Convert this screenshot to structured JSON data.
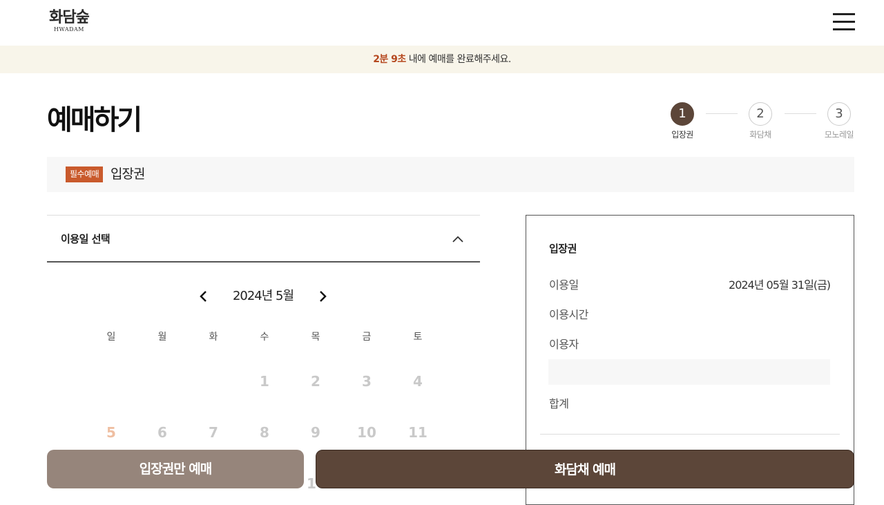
{
  "header": {
    "logo_ko": "화담숲",
    "logo_en": "HWADAM"
  },
  "timer": {
    "time": "2분 9초",
    "message": " 내에 예매를 완료해주세요."
  },
  "page_title": "예매하기",
  "steps": [
    {
      "number": "1",
      "label": "입장권"
    },
    {
      "number": "2",
      "label": "화담채"
    },
    {
      "number": "3",
      "label": "모노레일"
    }
  ],
  "section": {
    "badge": "필수예매",
    "title": "입장권"
  },
  "date_select": {
    "title": "이용일 선택"
  },
  "calendar": {
    "month_label": "2024년 5월",
    "weekdays": [
      "일",
      "월",
      "화",
      "수",
      "목",
      "금",
      "토"
    ],
    "week1": [
      "1",
      "2",
      "3",
      "4"
    ],
    "week2": [
      "5",
      "6",
      "7",
      "8",
      "9",
      "10",
      "11"
    ],
    "partial": "1"
  },
  "summary": {
    "title": "입장권",
    "date_label": "이용일",
    "date_value": "2024년 05월 31일(금)",
    "time_label": "이용시간",
    "people_label": "이용자",
    "total_label": "합계"
  },
  "buttons": {
    "ticket_only": "입장권만 예매",
    "hwadamchae": "화담채 예매"
  }
}
